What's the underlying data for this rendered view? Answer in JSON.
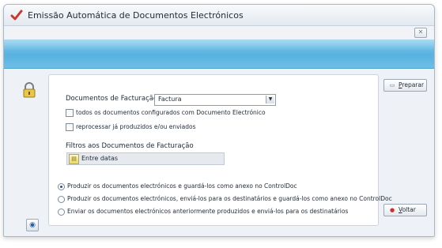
{
  "window": {
    "title": "Emissão Automática de Documentos Electrónicos",
    "close_label": "✕"
  },
  "form": {
    "doc_label": "Documentos de Facturação",
    "doc_value": "Factura",
    "check_all_label": "todos os documentos configurados com Documento Electrónico",
    "check_all_checked": false,
    "reprocess_label": "reprocessar já produzidos e/ou enviados",
    "reprocess_checked": false,
    "filters_label": "Filtros aos Documentos de Facturação",
    "filter_value": "Entre datas"
  },
  "options": {
    "selected": 0,
    "items": [
      "Produzir os documentos electrónicos e guardá-los como anexo no ControlDoc",
      "Produzir os documentos electrónicos, enviá-los para os destinatários e guardá-los como anexo no ControlDoc",
      "Enviar os documentos electrónicos anteriormente produzidos e enviá-los para os destinatários"
    ]
  },
  "buttons": {
    "prepare": "Preparar",
    "back": "Voltar"
  },
  "icons": {
    "app": "checkmark-icon",
    "lock": "lock-icon",
    "filter": "calendar-filter-icon",
    "help": "help-icon"
  },
  "colors": {
    "banner": "#58b1df",
    "accent": "#1d4f96"
  }
}
